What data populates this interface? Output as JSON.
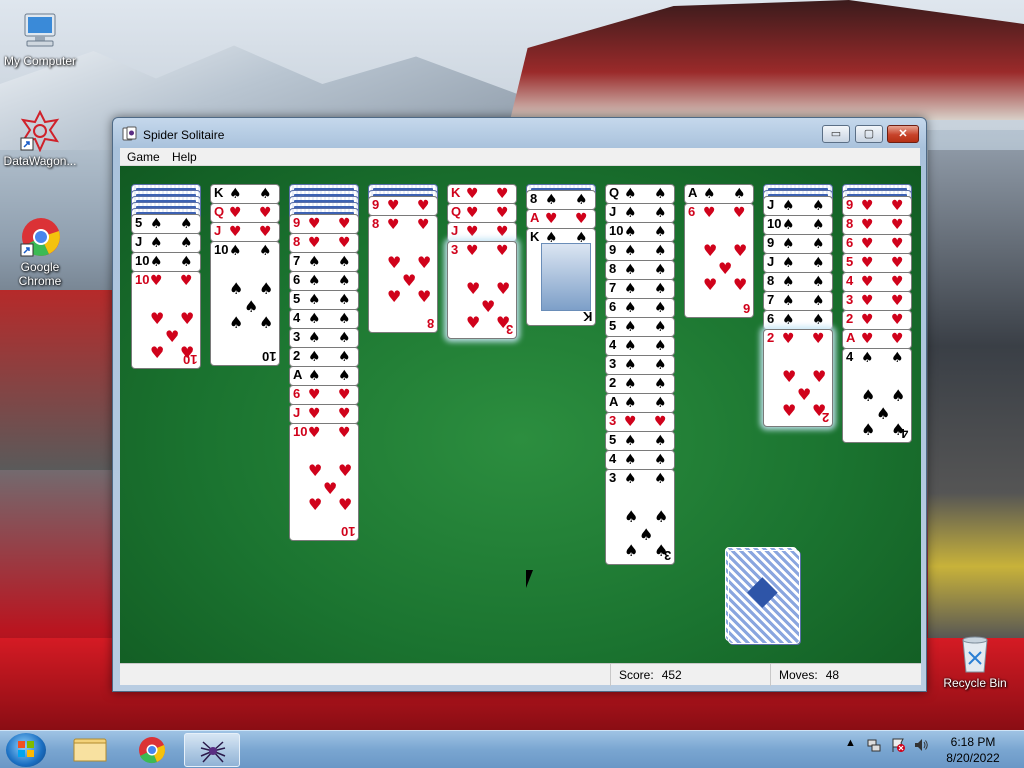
{
  "desktop": {
    "icons": [
      {
        "label": "My Computer",
        "icon": "computer-icon"
      },
      {
        "label": "DataWagon...",
        "icon": "datawagon-icon"
      },
      {
        "label": "Google Chrome",
        "icon": "chrome-icon"
      },
      {
        "label": "Recycle Bin",
        "icon": "recycle-bin-icon"
      }
    ]
  },
  "window": {
    "title": "Spider Solitaire",
    "buttons": {
      "minimize": "▭",
      "maximize": "▢",
      "close": "✕"
    },
    "menu": [
      "Game",
      "Help"
    ],
    "status": {
      "score_label": "Score:",
      "score": "452",
      "moves_label": "Moves:",
      "moves": "48"
    }
  },
  "tableau": [
    {
      "backs": 5,
      "cards": [
        {
          "r": "5",
          "s": "♠"
        },
        {
          "r": "J",
          "s": "♠"
        },
        {
          "r": "10",
          "s": "♠"
        },
        {
          "r": "10",
          "s": "♥"
        }
      ]
    },
    {
      "backs": 0,
      "cards": [
        {
          "r": "K",
          "s": "♠"
        },
        {
          "r": "Q",
          "s": "♥"
        },
        {
          "r": "J",
          "s": "♥"
        },
        {
          "r": "10",
          "s": "♠"
        }
      ]
    },
    {
      "backs": 5,
      "cards": [
        {
          "r": "9",
          "s": "♥"
        },
        {
          "r": "8",
          "s": "♥"
        },
        {
          "r": "7",
          "s": "♠"
        },
        {
          "r": "6",
          "s": "♠"
        },
        {
          "r": "5",
          "s": "♠"
        },
        {
          "r": "4",
          "s": "♠"
        },
        {
          "r": "3",
          "s": "♠"
        },
        {
          "r": "2",
          "s": "♠"
        },
        {
          "r": "A",
          "s": "♠"
        },
        {
          "r": "6",
          "s": "♥"
        },
        {
          "r": "J",
          "s": "♥"
        },
        {
          "r": "10",
          "s": "♥"
        }
      ]
    },
    {
      "backs": 2,
      "cards": [
        {
          "r": "9",
          "s": "♥"
        },
        {
          "r": "8",
          "s": "♥"
        }
      ]
    },
    {
      "backs": 0,
      "cards": [
        {
          "r": "K",
          "s": "♥"
        },
        {
          "r": "Q",
          "s": "♥"
        },
        {
          "r": "J",
          "s": "♥"
        },
        {
          "r": "3",
          "s": "♥"
        }
      ]
    },
    {
      "backs": 1,
      "cards": [
        {
          "r": "8",
          "s": "♠"
        },
        {
          "r": "A",
          "s": "♥"
        },
        {
          "r": "K",
          "s": "♠"
        }
      ]
    },
    {
      "backs": 0,
      "cards": [
        {
          "r": "Q",
          "s": "♠"
        },
        {
          "r": "J",
          "s": "♠"
        },
        {
          "r": "10",
          "s": "♠"
        },
        {
          "r": "9",
          "s": "♠"
        },
        {
          "r": "8",
          "s": "♠"
        },
        {
          "r": "7",
          "s": "♠"
        },
        {
          "r": "6",
          "s": "♠"
        },
        {
          "r": "5",
          "s": "♠"
        },
        {
          "r": "4",
          "s": "♠"
        },
        {
          "r": "3",
          "s": "♠"
        },
        {
          "r": "2",
          "s": "♠"
        },
        {
          "r": "A",
          "s": "♠"
        },
        {
          "r": "3",
          "s": "♥"
        },
        {
          "r": "5",
          "s": "♠"
        },
        {
          "r": "4",
          "s": "♠"
        },
        {
          "r": "3",
          "s": "♠"
        }
      ]
    },
    {
      "backs": 0,
      "cards": [
        {
          "r": "A",
          "s": "♠"
        },
        {
          "r": "6",
          "s": "♥"
        }
      ]
    },
    {
      "backs": 2,
      "cards": [
        {
          "r": "J",
          "s": "♠"
        },
        {
          "r": "10",
          "s": "♠"
        },
        {
          "r": "9",
          "s": "♠"
        },
        {
          "r": "J",
          "s": "♠"
        },
        {
          "r": "8",
          "s": "♠"
        },
        {
          "r": "7",
          "s": "♠"
        },
        {
          "r": "6",
          "s": "♠"
        },
        {
          "r": "2",
          "s": "♥"
        }
      ]
    },
    {
      "backs": 2,
      "cards": [
        {
          "r": "9",
          "s": "♥"
        },
        {
          "r": "8",
          "s": "♥"
        },
        {
          "r": "6",
          "s": "♥"
        },
        {
          "r": "5",
          "s": "♥"
        },
        {
          "r": "4",
          "s": "♥"
        },
        {
          "r": "3",
          "s": "♥"
        },
        {
          "r": "2",
          "s": "♥"
        },
        {
          "r": "A",
          "s": "♥"
        },
        {
          "r": "4",
          "s": "♠"
        }
      ]
    }
  ],
  "taskbar": {
    "apps": [
      "start-icon",
      "explorer-icon",
      "chrome-icon",
      "spider-solitaire-icon"
    ],
    "time": "6:18 PM",
    "date": "8/20/2022"
  }
}
